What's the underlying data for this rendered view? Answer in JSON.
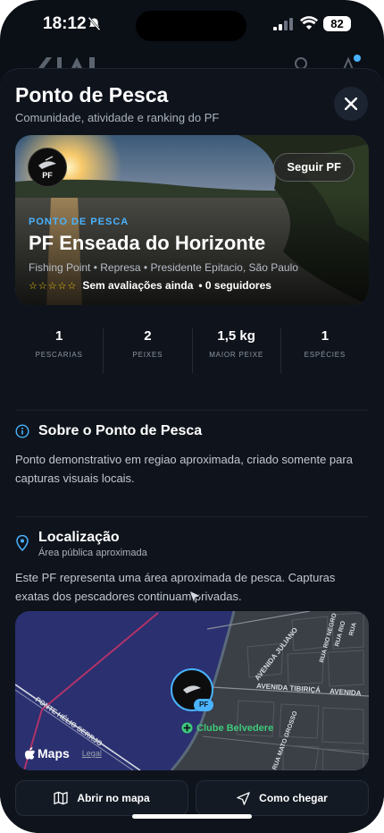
{
  "status_bar": {
    "time": "18:12",
    "battery": "82"
  },
  "sheet": {
    "title": "Ponto de Pesca",
    "subtitle": "Comunidade, atividade e ranking do PF"
  },
  "hero": {
    "avatar_text": "PF",
    "follow_label": "Seguir PF",
    "kicker": "PONTO DE PESCA",
    "name": "PF Enseada do Horizonte",
    "meta": "Fishing Point • Represa • Presidente Epitacio, São Paulo",
    "stars": "☆☆☆☆☆",
    "rating_text": "Sem avaliações ainda",
    "followers": "• 0 seguidores"
  },
  "stats": [
    {
      "value": "1",
      "label": "PESCARIAS"
    },
    {
      "value": "2",
      "label": "PEIXES"
    },
    {
      "value": "1,5 kg",
      "label": "MAIOR PEIXE"
    },
    {
      "value": "1",
      "label": "ESPÉCIES"
    }
  ],
  "about": {
    "title": "Sobre o Ponto de Pesca",
    "text": "Ponto demonstrativo em regiao aproximada, criado somente para capturas visuais locais."
  },
  "location": {
    "title": "Localização",
    "subtitle": "Área pública aproximada",
    "text": "Este PF representa uma área aproximada de pesca. Capturas exatas dos pescadores continuam privadas."
  },
  "map": {
    "provider": "Maps",
    "legal": "Legal",
    "pin_badge": "PF",
    "poi": "Clube Belvedere",
    "streets": [
      "AVENIDA JULIANO",
      "AVENIDA TIBIRIÇÁ",
      "AVENIDA",
      "PONTE HÉLIO SERRJO",
      "RUA RIO NEGRO",
      "RUA RIO",
      "RUA",
      "RUA MATO GROSSO"
    ]
  },
  "actions": {
    "open_map": "Abrir no mapa",
    "directions": "Como chegar"
  },
  "colors": {
    "accent": "#49b3ff",
    "background": "#0f141c",
    "star": "#f1c40f",
    "poi": "#3ec97a"
  }
}
